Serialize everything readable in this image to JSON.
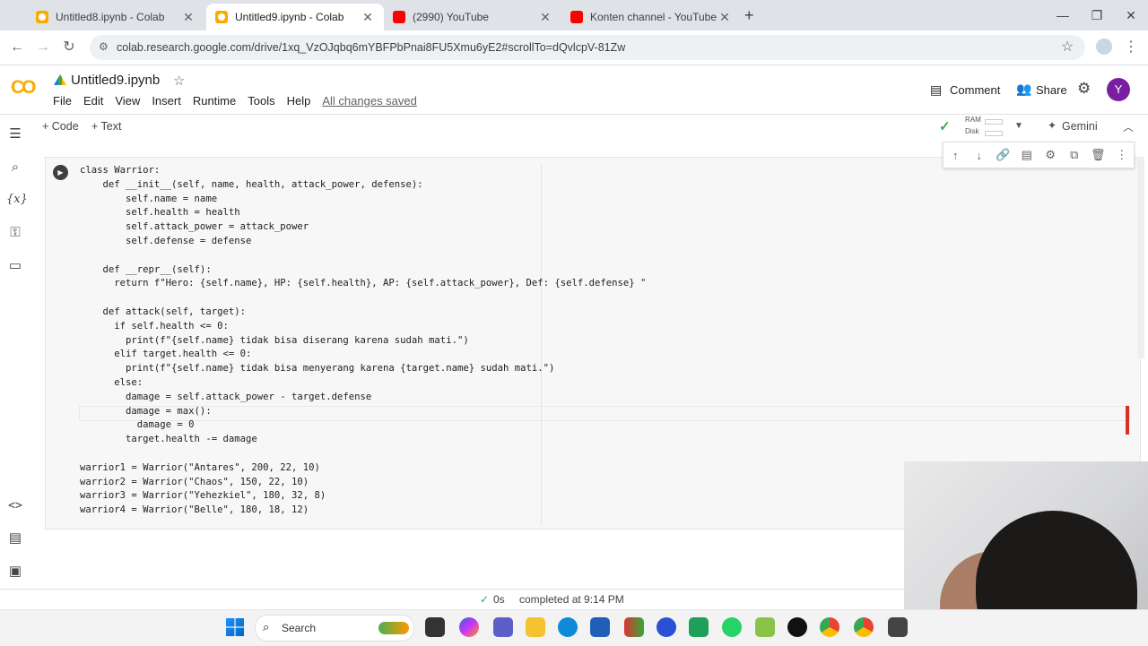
{
  "browser": {
    "tabs": [
      {
        "title": "Untitled8.ipynb - Colab",
        "icon": "colab-icon",
        "active": false
      },
      {
        "title": "Untitled9.ipynb - Colab",
        "icon": "colab-icon",
        "active": true
      },
      {
        "title": "(2990) YouTube",
        "icon": "youtube-icon",
        "active": false
      },
      {
        "title": "Konten channel - YouTube Studi",
        "icon": "youtube-studio-icon",
        "active": false
      }
    ],
    "new_tab_glyph": "+",
    "url": "colab.research.google.com/drive/1xq_VzOJqbq6mYBFPbPnai8FU5Xmu6yE2#scrollTo=dQvlcpV-81Zw",
    "window_controls": [
      "minimize-icon",
      "restore-icon",
      "close-icon"
    ]
  },
  "colab": {
    "logo": "CO",
    "title": "Untitled9.ipynb",
    "menu": [
      "File",
      "Edit",
      "View",
      "Insert",
      "Runtime",
      "Tools",
      "Help"
    ],
    "save_status": "All changes saved",
    "comment_label": "Comment",
    "share_label": "Share",
    "avatar_initial": "Y",
    "toolbar": {
      "code_label": "+ Code",
      "text_label": "+ Text",
      "ram_label": "RAM",
      "disk_label": "Disk",
      "gemini_label": "Gemini"
    },
    "cell_code": "class Warrior:\n    def __init__(self, name, health, attack_power, defense):\n        self.name = name\n        self.health = health\n        self.attack_power = attack_power\n        self.defense = defense\n\n    def __repr__(self):\n      return f\"Hero: {self.name}, HP: {self.health}, AP: {self.attack_power}, Def: {self.defense} \"\n\n    def attack(self, target):\n      if self.health <= 0:\n        print(f\"{self.name} tidak bisa diserang karena sudah mati.\")\n      elif target.health <= 0:\n        print(f\"{self.name} tidak bisa menyerang karena {target.name} sudah mati.\")\n      else:\n        damage = self.attack_power - target.defense\n        damage = max():\n          damage = 0\n        target.health -= damage\n\nwarrior1 = Warrior(\"Antares\", 200, 22, 10)\nwarrior2 = Warrior(\"Chaos\", 150, 22, 10)\nwarrior3 = Warrior(\"Yehezkiel\", 180, 32, 8)\nwarrior4 = Warrior(\"Belle\", 180, 18, 12)",
    "status": {
      "check": "✓",
      "duration": "0s",
      "completed": "completed at 9:14 PM"
    }
  },
  "taskbar": {
    "search_label": "Search"
  },
  "colors": {
    "colab_orange": "#f9ab00",
    "youtube_red": "#ff0000",
    "avatar_purple": "#7b1fa2",
    "error_red": "#d93025"
  }
}
